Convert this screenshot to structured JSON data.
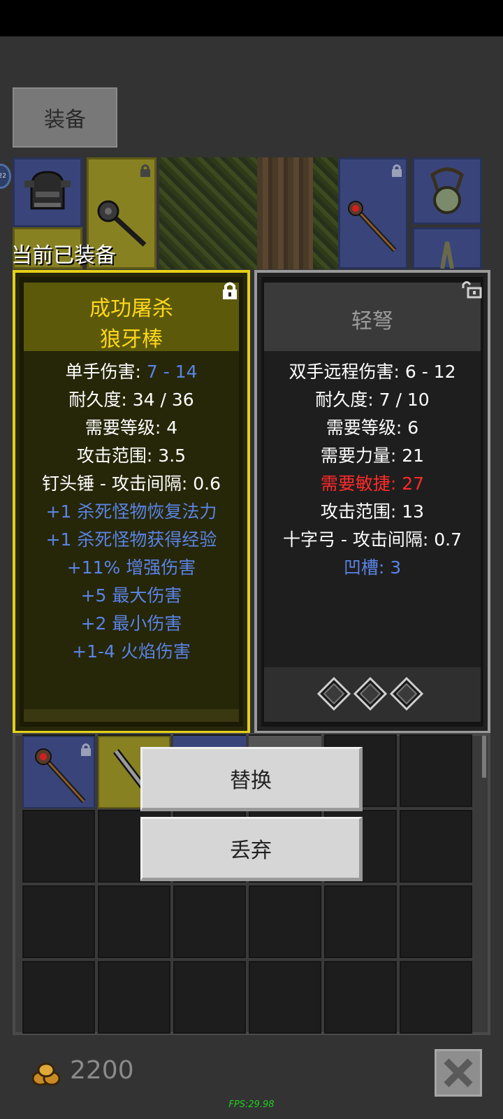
{
  "tab": {
    "label": "装备"
  },
  "equipped_label": "当前已装备",
  "level_badge": "22",
  "current_item": {
    "name_line1": "成功屠杀",
    "name_line2": "狼牙棒",
    "stats": [
      {
        "label": "单手伤害: ",
        "value": "7 - 14",
        "color": "white",
        "value_color": "blue"
      },
      {
        "label": "耐久度: 34 / 36",
        "color": "white"
      },
      {
        "label": "需要等级: 4",
        "color": "white"
      },
      {
        "label": "攻击范围: 3.5",
        "color": "white"
      },
      {
        "label": "钉头锤 - 攻击间隔: 0.6",
        "color": "white"
      },
      {
        "label": "+1 杀死怪物恢复法力",
        "color": "blue"
      },
      {
        "label": "+1 杀死怪物获得经验",
        "color": "blue"
      },
      {
        "label": "+11% 增强伤害",
        "color": "blue"
      },
      {
        "label": "+5 最大伤害",
        "color": "blue"
      },
      {
        "label": "+2 最小伤害",
        "color": "blue"
      },
      {
        "label": "+1-4 火焰伤害",
        "color": "blue"
      }
    ]
  },
  "compare_item": {
    "name": "轻弩",
    "stats": [
      {
        "label": "双手远程伤害: 6 - 12",
        "color": "white"
      },
      {
        "label": "耐久度: 7 / 10",
        "color": "white"
      },
      {
        "label": "需要等级: 6",
        "color": "white"
      },
      {
        "label": "需要力量: 21",
        "color": "white"
      },
      {
        "label": "需要敏捷: 27",
        "color": "red"
      },
      {
        "label": "攻击范围: 13",
        "color": "white"
      },
      {
        "label": "十字弓 - 攻击间隔: 0.7",
        "color": "white"
      },
      {
        "label": "凹槽: 3",
        "color": "blue"
      }
    ],
    "sockets": 3
  },
  "actions": {
    "replace": "替换",
    "drop": "丢弃"
  },
  "gold": "2200",
  "fps": "FPS:29.98",
  "colors": {
    "gold_frame": "#e5d018",
    "blue_text": "#5a84e6",
    "red_text": "#ff2a2a"
  }
}
